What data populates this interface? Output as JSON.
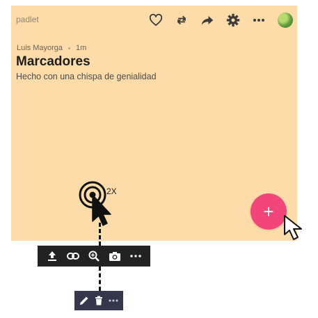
{
  "header": {
    "brand": "padlet",
    "actions": [
      {
        "icon": "heart-icon"
      },
      {
        "icon": "repost-icon"
      },
      {
        "icon": "share-icon"
      },
      {
        "icon": "gear-icon"
      },
      {
        "icon": "more-icon"
      },
      {
        "icon": "avatar"
      }
    ]
  },
  "board": {
    "author": "Luis Mayorga",
    "time": "1m",
    "title": "Marcadores",
    "subtitle": "Hecho con una chispa de genialidad",
    "background": "#fedcaa"
  },
  "annotation": {
    "tap_label": "2X"
  },
  "fab": {
    "label": "+",
    "color": "#f2457a"
  },
  "post_toolbar": {
    "icons": [
      "upload-icon",
      "link-icon",
      "search-web-icon",
      "camera-icon",
      "more-icon"
    ]
  },
  "edit_toolbar": {
    "icons": [
      "pencil-icon",
      "trash-icon",
      "more-icon"
    ]
  }
}
